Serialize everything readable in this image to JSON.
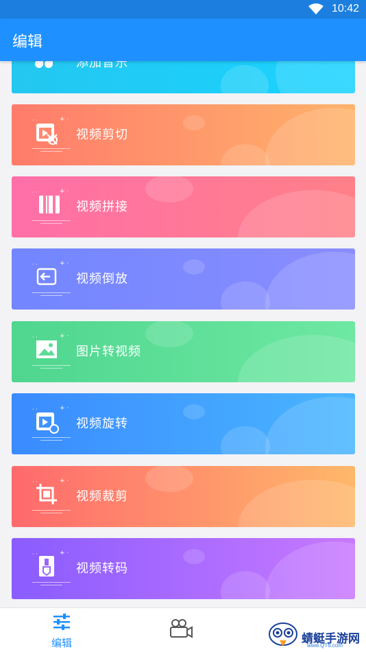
{
  "status_bar": {
    "time": "10:42"
  },
  "app_bar": {
    "title": "编辑"
  },
  "cards": [
    {
      "label": "添加音乐",
      "icon": "music-notes-icon",
      "gradient": [
        "#24c7f0",
        "#19d3ff"
      ]
    },
    {
      "label": "视频剪切",
      "icon": "video-cut-icon",
      "gradient": [
        "#ff7b6b",
        "#ffb36b"
      ]
    },
    {
      "label": "视频拼接",
      "icon": "video-merge-icon",
      "gradient": [
        "#ff6fa8",
        "#ff8088"
      ]
    },
    {
      "label": "视频倒放",
      "icon": "video-reverse-icon",
      "gradient": [
        "#7286ff",
        "#8a8dff"
      ]
    },
    {
      "label": "图片转视频",
      "icon": "image-to-video-icon",
      "gradient": [
        "#4fd68f",
        "#6ee8a2"
      ]
    },
    {
      "label": "视频旋转",
      "icon": "video-rotate-icon",
      "gradient": [
        "#3a8bff",
        "#4ab6ff"
      ]
    },
    {
      "label": "视频裁剪",
      "icon": "video-crop-icon",
      "gradient": [
        "#ff6a6d",
        "#ffb86a"
      ]
    },
    {
      "label": "视频转码",
      "icon": "video-transcode-icon",
      "gradient": [
        "#8a5cff",
        "#c879ff"
      ]
    }
  ],
  "bottom_nav": {
    "edit_label": "编辑",
    "edit_icon": "sliders-icon",
    "video_icon": "video-camera-icon",
    "active_color": "#1e90ff"
  },
  "watermark": {
    "text": "蜻蜓手游网",
    "sub": "www.QT6.com"
  }
}
